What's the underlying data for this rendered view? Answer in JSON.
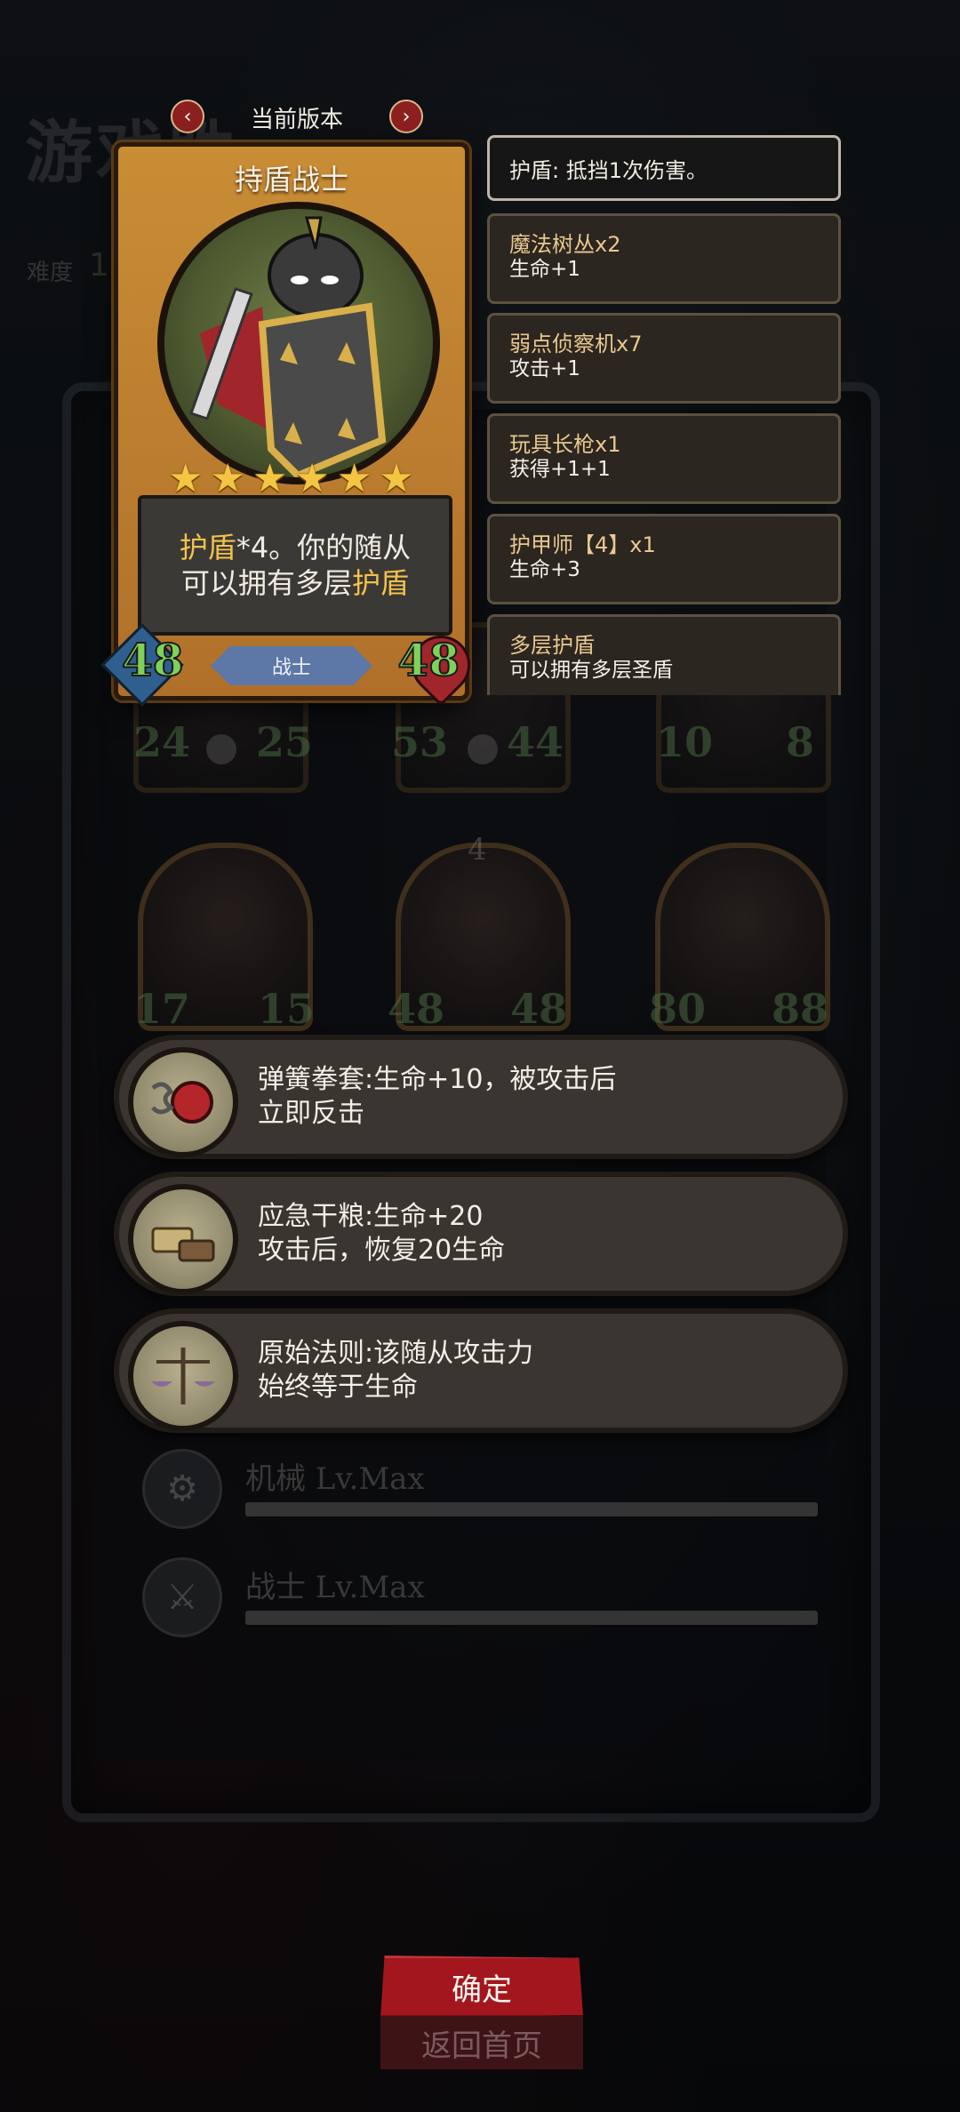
{
  "background": {
    "title": "游戏胜",
    "difficulty_label": "难度",
    "difficulty_value": "1",
    "minions_row1": [
      {
        "atk": "24",
        "hp": "25"
      },
      {
        "atk": "53",
        "hp": "44"
      },
      {
        "atk": "10",
        "hp": "8"
      }
    ],
    "minions_row2": [
      {
        "atk": "17",
        "hp": "15",
        "level": ""
      },
      {
        "atk": "48",
        "hp": "48",
        "level": "4"
      },
      {
        "atk": "80",
        "hp": "88",
        "level": ""
      }
    ],
    "tribes": [
      {
        "label": "机械 Lv.Max",
        "icon": "mech-icon",
        "progress": 1.0
      },
      {
        "label": "战士 Lv.Max",
        "icon": "warrior-icon",
        "progress": 1.0
      }
    ]
  },
  "version_nav": {
    "label": "当前版本",
    "prev_icon": "chevron-left-icon",
    "next_icon": "chevron-right-icon"
  },
  "card": {
    "name": "持盾战士",
    "stars": 6,
    "desc_part1": "护盾",
    "desc_part2": "*4。你的随从",
    "desc_part3": "可以拥有多层",
    "desc_part4": "护盾",
    "tribe": "战士",
    "attack": "48",
    "health": "48"
  },
  "effects": {
    "header": "护盾: 抵挡1次伤害。",
    "items": [
      {
        "title": "魔法树丛x2",
        "body": "生命+1"
      },
      {
        "title": "弱点侦察机x7",
        "body": "攻击+1"
      },
      {
        "title": "玩具长枪x1",
        "body": "获得+1+1"
      },
      {
        "title": "护甲师【4】x1",
        "body": "生命+3"
      },
      {
        "title": "多层护盾",
        "body": "可以拥有多层圣盾"
      }
    ]
  },
  "relics": [
    {
      "line1": "弹簧拳套:生命+10，被攻击后",
      "line2": "立即反击",
      "icon": "spring-glove-icon"
    },
    {
      "line1": "应急干粮:生命+20",
      "line2": "攻击后，恢复20生命",
      "icon": "ration-icon"
    },
    {
      "line1": "原始法则:该随从攻击力",
      "line2": "始终等于生命",
      "icon": "balance-scale-icon"
    }
  ],
  "buttons": {
    "confirm": "确定",
    "return": "返回首页"
  },
  "colors": {
    "card_gold": "#c98d35",
    "highlight": "#f3c24b",
    "confirm_red": "#a3161d",
    "stat_green": "#7fd15a",
    "tribe_blue": "#5d77a6"
  }
}
